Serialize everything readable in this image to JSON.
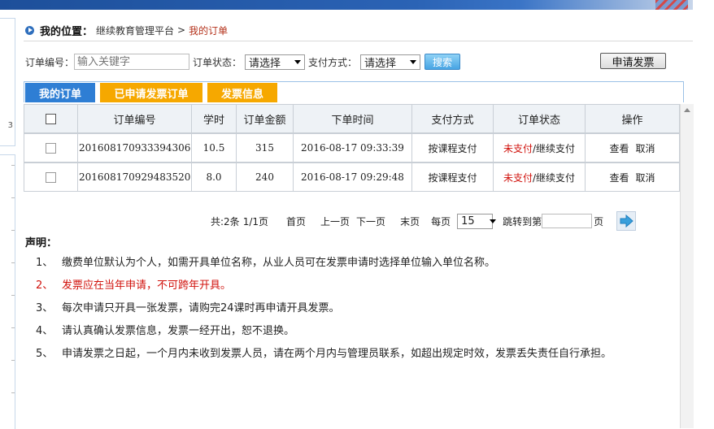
{
  "breadcrumb": {
    "label": "我的位置：",
    "platform": "继续教育管理平台",
    "separator": ">",
    "current": "我的订单"
  },
  "filters": {
    "order_no_label": "订单编号：",
    "order_no_placeholder": "输入关键字",
    "status_label": "订单状态：",
    "status_value": "请选择",
    "payment_label": "支付方式：",
    "payment_value": "请选择",
    "search_button": "搜索",
    "apply_invoice_button": "申请发票"
  },
  "tabs": [
    {
      "label": "我的订单",
      "active": true
    },
    {
      "label": "已申请发票订单",
      "active": false
    },
    {
      "label": "发票信息",
      "active": false
    }
  ],
  "table": {
    "headers": [
      "",
      "订单编号",
      "学时",
      "订单金额",
      "下单时间",
      "支付方式",
      "订单状态",
      "操作"
    ],
    "rows": [
      {
        "order_no": "201608170933394306",
        "hours": "10.5",
        "amount": "315",
        "time": "2016-08-17 09:33:39",
        "payment": "按课程支付",
        "status_unpaid": "未支付",
        "status_sep": "/",
        "status_continue": "继续支付",
        "action_view": "查看",
        "action_cancel": "取消"
      },
      {
        "order_no": "201608170929483520",
        "hours": "8.0",
        "amount": "240",
        "time": "2016-08-17 09:29:48",
        "payment": "按课程支付",
        "status_unpaid": "未支付",
        "status_sep": "/",
        "status_continue": "继续支付",
        "action_view": "查看",
        "action_cancel": "取消"
      }
    ]
  },
  "pager": {
    "total": "共:2条",
    "page": "1/1页",
    "first": "首页",
    "prev": "上一页",
    "next": "下一页",
    "last": "末页",
    "per_page_label": "每页",
    "per_page_value": "15",
    "jump_label": "跳转到第",
    "jump_suffix": "页"
  },
  "declaration": {
    "title": "声明：",
    "items": [
      {
        "num": "1、",
        "text": "缴费单位默认为个人，如需开具单位名称，从业人员可在发票申请时选择单位输入单位名称。"
      },
      {
        "num": "2、",
        "text": "发票应在当年申请，不可跨年开具。"
      },
      {
        "num": "3、",
        "text": "每次申请只开具一张发票，请购完24课时再申请开具发票。"
      },
      {
        "num": "4、",
        "text": "请认真确认发票信息，发票一经开出，恕不退换。"
      },
      {
        "num": "5、",
        "text": "申请发票之日起，一个月内未收到发票人员，请在两个月内与管理员联系，如超出规定时效，发票丢失责任自行承担。"
      }
    ]
  },
  "left_panel_number": "3",
  "colors": {
    "unpaid": "#d1120c",
    "tab_active": "#2e7ed4",
    "tab_inactive": "#f6a800",
    "breadcrumb_current": "#b4321b"
  }
}
